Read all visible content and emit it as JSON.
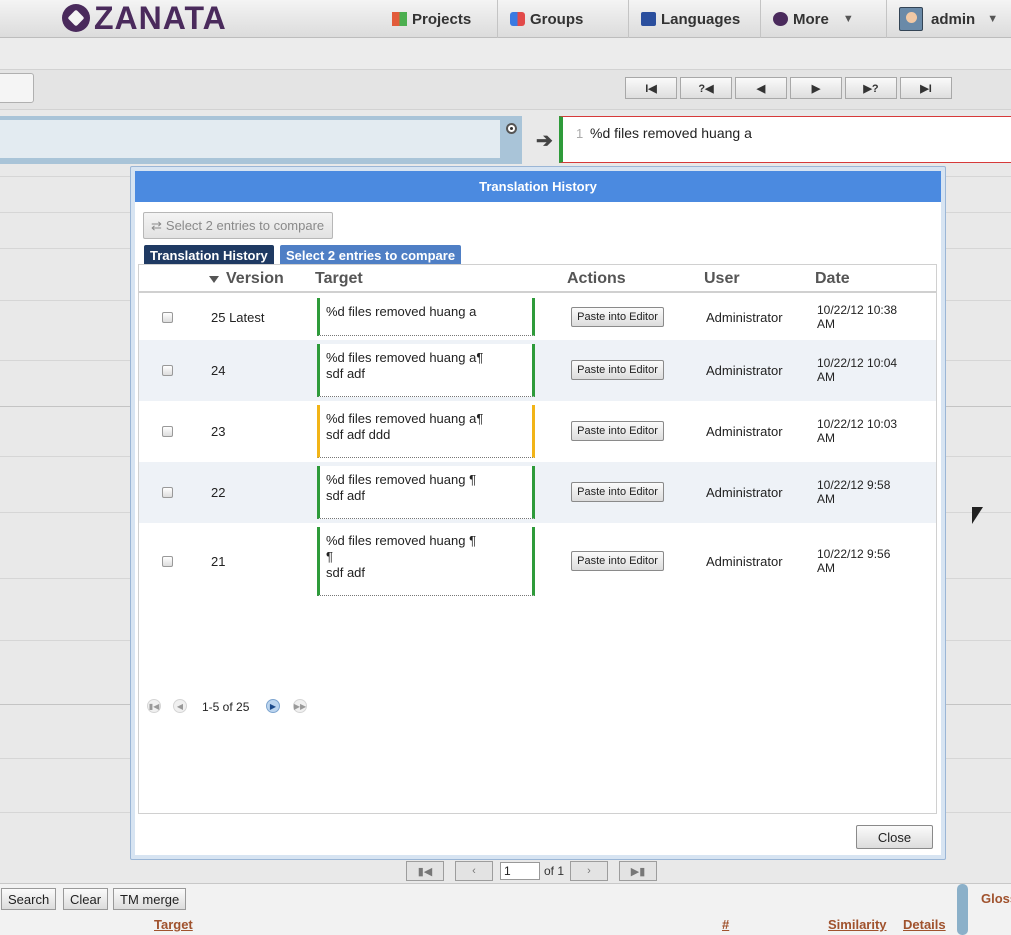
{
  "app": {
    "logo_text": "ZANATA"
  },
  "nav": {
    "projects": "Projects",
    "groups": "Groups",
    "languages": "Languages",
    "more": "More",
    "user": "admin"
  },
  "editor": {
    "nav_buttons": [
      "I◀",
      "?◀",
      "◀",
      "▶",
      "▶?",
      "▶I"
    ],
    "target_line_no": "1",
    "target_text": "%d files removed huang a",
    "arrow": "➔"
  },
  "dialog": {
    "title": "Translation History",
    "compare_button": "Select 2 entries to compare",
    "compare_icon": "⇄",
    "tabs": [
      "Translation History",
      "Select 2 entries to compare"
    ],
    "columns": [
      "Version",
      "Target",
      "Actions",
      "User",
      "Date"
    ],
    "rows": [
      {
        "version": "25 Latest",
        "target": [
          "%d files removed huang a"
        ],
        "action": "Paste into Editor",
        "user": "Administrator",
        "date": [
          "10/22/12 10:38",
          "AM"
        ],
        "state": "approved"
      },
      {
        "version": "24",
        "target": [
          "%d files removed huang a¶",
          "sdf adf"
        ],
        "action": "Paste into Editor",
        "user": "Administrator",
        "date": [
          "10/22/12 10:04",
          "AM"
        ],
        "state": "approved"
      },
      {
        "version": "23",
        "target": [
          "%d files removed huang a¶",
          "sdf adf ddd"
        ],
        "action": "Paste into Editor",
        "user": "Administrator",
        "date": [
          "10/22/12 10:03",
          "AM"
        ],
        "state": "fuzzy"
      },
      {
        "version": "22",
        "target": [
          "%d files removed huang ¶",
          "sdf adf"
        ],
        "action": "Paste into Editor",
        "user": "Administrator",
        "date": [
          "10/22/12 9:58",
          "AM"
        ],
        "state": "approved"
      },
      {
        "version": "21",
        "target": [
          "%d files removed huang ¶",
          "¶",
          "sdf adf"
        ],
        "action": "Paste into Editor",
        "user": "Administrator",
        "date": [
          "10/22/12 9:56",
          "AM"
        ],
        "state": "approved"
      }
    ],
    "pagination": "1-5 of 25",
    "close": "Close"
  },
  "footer": {
    "page_value": "1",
    "page_of": "of 1",
    "search": "Search",
    "clear": "Clear",
    "tm_merge": "TM merge",
    "target": "Target",
    "hash": "#",
    "similarity": "Similarity",
    "details": "Details",
    "glossary": "Gloss"
  },
  "colors": {
    "accent": "#4b8ae0",
    "approved": "#2e9b3a",
    "fuzzy": "#f2b417",
    "brand": "#4a2a5c"
  }
}
